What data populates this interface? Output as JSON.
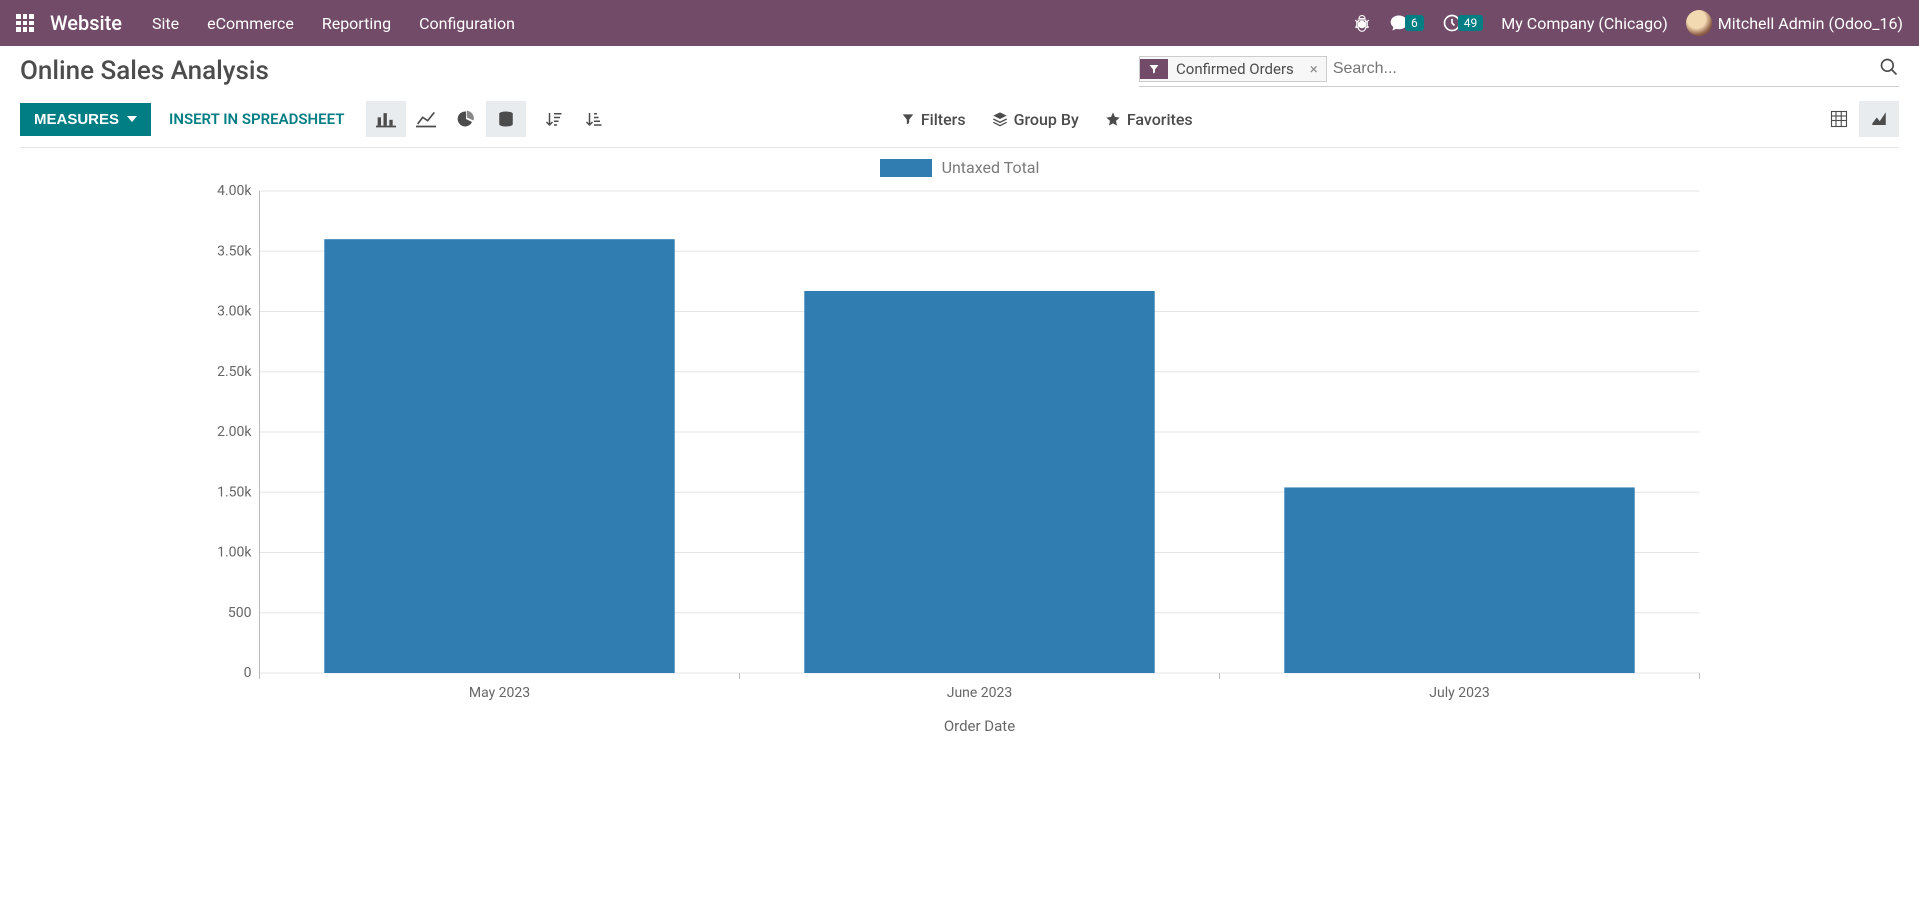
{
  "navbar": {
    "brand": "Website",
    "menu": [
      "Site",
      "eCommerce",
      "Reporting",
      "Configuration"
    ],
    "messages_badge": "6",
    "activities_badge": "49",
    "company": "My Company (Chicago)",
    "user": "Mitchell Admin (Odoo_16)"
  },
  "page": {
    "title": "Online Sales Analysis"
  },
  "search": {
    "filter_label": "Confirmed Orders",
    "placeholder": "Search..."
  },
  "toolbar": {
    "measures_label": "MEASURES",
    "insert_label": "INSERT IN SPREADSHEET",
    "filters_label": "Filters",
    "groupby_label": "Group By",
    "favorites_label": "Favorites"
  },
  "legend": {
    "label": "Untaxed Total"
  },
  "chart_data": {
    "type": "bar",
    "categories": [
      "May 2023",
      "June 2023",
      "July 2023"
    ],
    "values": [
      3600,
      3170,
      1540
    ],
    "series_name": "Untaxed Total",
    "xlabel": "Order Date",
    "ylabel": "",
    "ylim": [
      0,
      4000
    ],
    "yticks": [
      0,
      500,
      1000,
      1500,
      2000,
      2500,
      3000,
      3500,
      4000
    ],
    "ytick_labels": [
      "0",
      "500",
      "1.00k",
      "1.50k",
      "2.00k",
      "2.50k",
      "3.00k",
      "3.50k",
      "4.00k"
    ],
    "color": "#2f7db1"
  }
}
